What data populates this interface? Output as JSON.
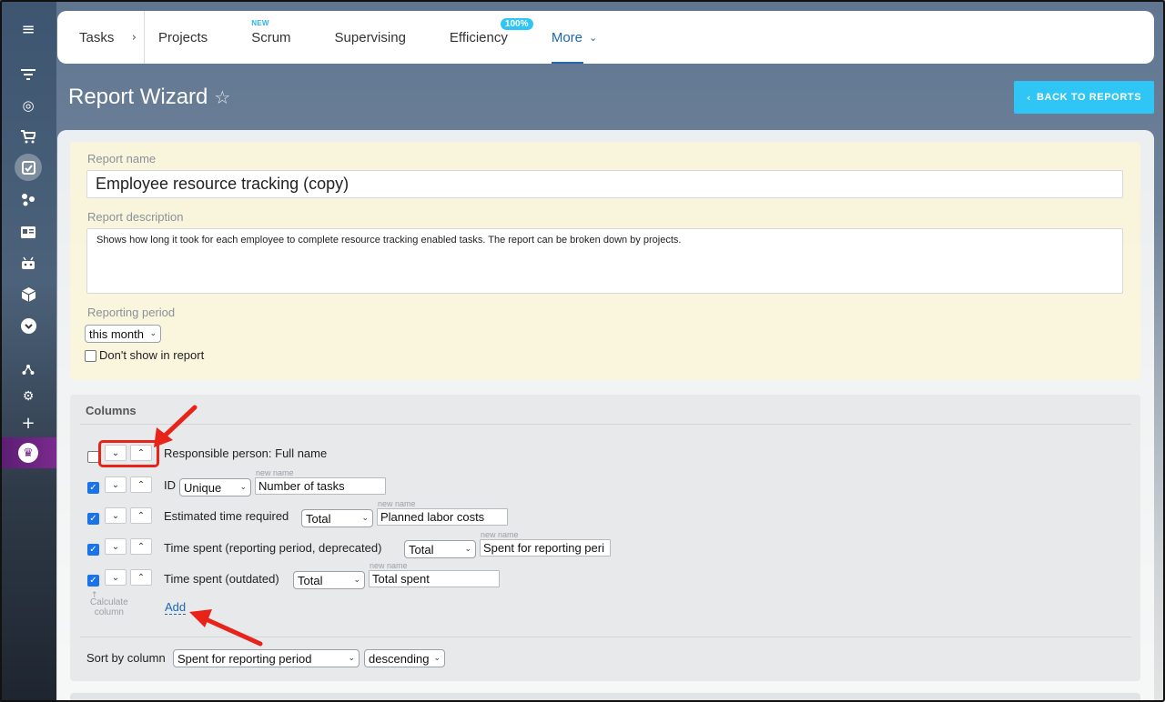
{
  "topnav": {
    "tasks": "Tasks",
    "projects": "Projects",
    "scrum": "Scrum",
    "scrum_badge": "NEW",
    "supervising": "Supervising",
    "efficiency": "Efficiency",
    "efficiency_badge": "100%",
    "more": "More"
  },
  "page": {
    "title": "Report Wizard",
    "back_button": "BACK TO REPORTS"
  },
  "form": {
    "report_name_label": "Report name",
    "report_name_value": "Employee resource tracking (copy)",
    "report_description_label": "Report description",
    "report_description_value": "Shows how long it took for each employee to complete resource tracking enabled tasks. The report can be broken down by projects.",
    "reporting_period_label": "Reporting period",
    "reporting_period_value": "this month",
    "dont_show_label": "Don't show in report",
    "dont_show_checked": false
  },
  "columns": {
    "header": "Columns",
    "new_name_label": "new name",
    "rows": [
      {
        "checked": false,
        "label": "Responsible person: Full name",
        "aggregate": "",
        "new_name": ""
      },
      {
        "checked": true,
        "label": "ID",
        "aggregate": "Unique",
        "new_name": "Number of tasks"
      },
      {
        "checked": true,
        "label": "Estimated time required",
        "aggregate": "Total",
        "new_name": "Planned labor costs"
      },
      {
        "checked": true,
        "label": "Time spent (reporting period, deprecated)",
        "aggregate": "Total",
        "new_name": "Spent for reporting peri"
      },
      {
        "checked": true,
        "label": "Time spent (outdated)",
        "aggregate": "Total",
        "new_name": "Total spent"
      }
    ],
    "calculate_line1": "Calculate",
    "calculate_line2": "column",
    "add_link": "Add"
  },
  "sort": {
    "label": "Sort by column",
    "column_value": "Spent for reporting period",
    "order_value": "descending"
  },
  "colors": {
    "accent": "#2fc6f6",
    "link": "#2067b0",
    "highlight": "#e8231a"
  },
  "icons": {
    "sidebar": [
      "menu-icon",
      "filter-icon",
      "target-icon",
      "cart-icon",
      "tasks-checkbox-icon",
      "sites-icon",
      "contact-card-icon",
      "android-icon",
      "box-icon",
      "chevron-down-circle-icon",
      "network-icon",
      "gear-icon",
      "plus-icon",
      "crown-icon"
    ]
  }
}
